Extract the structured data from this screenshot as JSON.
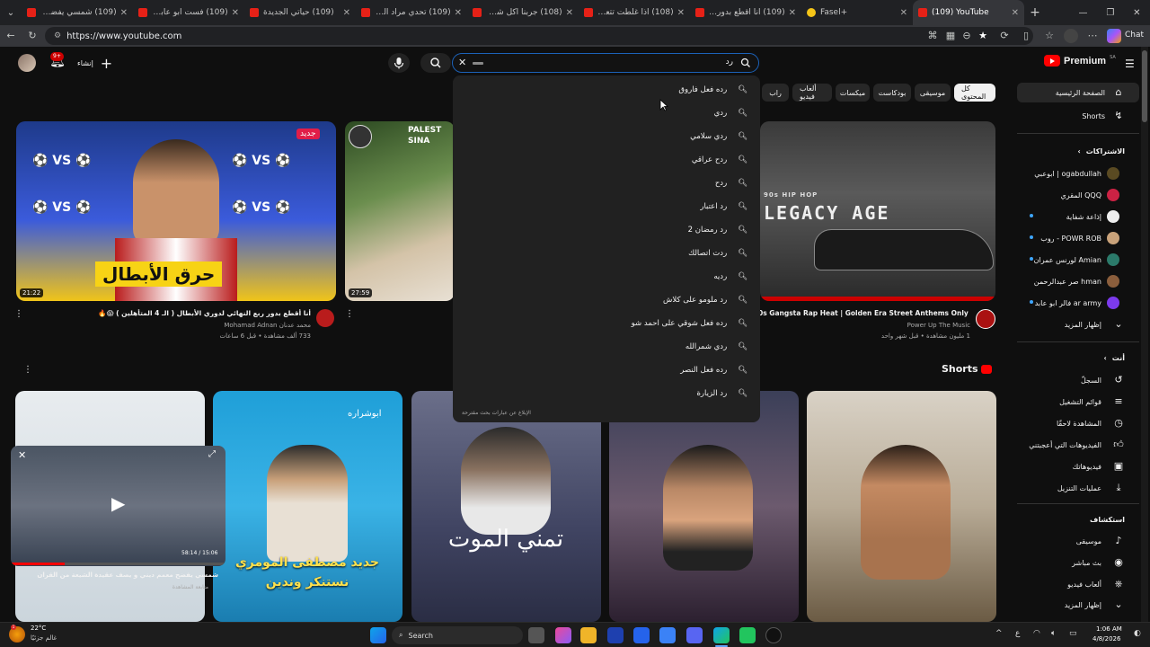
{
  "browser": {
    "tabs": [
      {
        "title": "(109) شمسي يفضح معمم",
        "active": false
      },
      {
        "title": "(109) فست ابو عابد مع ا",
        "active": false
      },
      {
        "title": "(109) حياتي الجديدة",
        "active": false
      },
      {
        "title": "(109) تحدي مراد الوقت ا",
        "active": false
      },
      {
        "title": "(108) جربنا أكل شوارع مة",
        "active": false
      },
      {
        "title": "(108) اذا غلطت تتعاقب",
        "active": false
      },
      {
        "title": "(109) أنا أقطع بدور ربع ال",
        "active": false
      },
      {
        "title": "Fasel+",
        "active": false
      },
      {
        "title": "(109) YouTube",
        "active": true
      }
    ],
    "url": "https://www.youtube.com",
    "chat_label": "Chat"
  },
  "header": {
    "brand": "Premium",
    "brand_badge": "SA",
    "create_label": "إنشاء",
    "notif_count": "9+",
    "search_value": "رد",
    "search_placeholder": ""
  },
  "suggestions": [
    "رده فعل فاروق",
    "ردي",
    "ردي سلامي",
    "ردح عراقي",
    "ردح",
    "رد اعتبار",
    "رد رمضان 2",
    "ردت اتصالك",
    "رديه",
    "رد ملومو على كلاش",
    "رده فعل شوقي على احمد شو",
    "ردي شمرالله",
    "رده فعل النصر",
    "رد الزيارة"
  ],
  "dropdown_footer": "الإبلاغ عن عبارات بحث مقترحة",
  "chips": [
    "كل المحتوى",
    "موسيقى",
    "بودكاست",
    "ميكسات",
    "ألعاب فيديو",
    "راب"
  ],
  "sidebar": {
    "main": [
      {
        "label": "الصفحة الرئيسية",
        "icon": "home-icon"
      },
      {
        "label": "Shorts",
        "icon": "shorts-icon"
      }
    ],
    "subscriptions_title": "الاشتراكات",
    "subscriptions": [
      "ogabdullah | ابوعبي",
      "QQQ المقري",
      "إذاعة شفاية",
      "POWR ROB - روب",
      "Amian لورنس عمران",
      "hman صر عبدالرحمن",
      "ar army فالر ابو عابد"
    ],
    "show_more": "إظهار المزيد",
    "you_title": "أنت",
    "you_items": [
      {
        "label": "السجلّ",
        "icon": "history-icon"
      },
      {
        "label": "قوائم التشغيل",
        "icon": "playlist-icon"
      },
      {
        "label": "المشاهدة لاحقًا",
        "icon": "clock-icon"
      },
      {
        "label": "الفيديوهات التي أعجبتني",
        "icon": "like-icon"
      },
      {
        "label": "فيديوهاتك",
        "icon": "your-videos-icon"
      },
      {
        "label": "عمليات التنزيل",
        "icon": "download-icon"
      }
    ],
    "explore_title": "استكشاف",
    "explore_items": [
      {
        "label": "موسيقى",
        "icon": "music-icon"
      },
      {
        "label": "بث مباشر",
        "icon": "live-icon"
      },
      {
        "label": "ألعاب فيديو",
        "icon": "gaming-icon"
      }
    ],
    "show_more_2": "إظهار المزيد"
  },
  "videos": [
    {
      "title": "أنا أقطع بدور ربع النهائي لدوري الأبطال ( الـ 4 المتأهلين ) 😱🔥",
      "channel": "محمد عدنان Mohamad Adnan",
      "meta": "733 ألف مشاهدة • قبل 6 ساعات",
      "duration": "21:22",
      "badge": "جديد",
      "thumb_text": "حرق الأبطال"
    },
    {
      "title": "",
      "channel": "",
      "meta": "",
      "duration": "27:59",
      "badge": "",
      "thumb_text": "PALEST SINA"
    },
    {
      "title": "0s Gangsta Rap Heat | Golden Era Street Anthems Only",
      "channel": "Power Up The Music",
      "meta": "1 مليون مشاهدة • قبل شهر واحد",
      "duration": "",
      "badge": "",
      "thumb_text": "LEGACY AGE",
      "thumb_subtext": "90s HIP HOP"
    }
  ],
  "shorts_title": "Shorts",
  "shorts": [
    {
      "text": ""
    },
    {
      "text": "جديد مصطفى المومري نستنكر وندين",
      "top_text": "ابوشراره"
    },
    {
      "text": "تمني الموت"
    },
    {
      "text": ""
    },
    {
      "text": ""
    }
  ],
  "miniplayer": {
    "title": "شمسي يفضح معمم ديني و يصف عقيدة الشيعة من القرآن",
    "sub": "متابعة المشاهدة",
    "time": "58:14 / 15:06"
  },
  "taskbar": {
    "weather_temp": "22°C",
    "weather_desc": "غالم جزئيًا",
    "search_placeholder": "Search",
    "time": "1:06 AM",
    "date": "4/8/2026"
  },
  "colors": {
    "accent": "#ff0000",
    "link": "#3ea6ff",
    "bg": "#0f0f0f"
  }
}
